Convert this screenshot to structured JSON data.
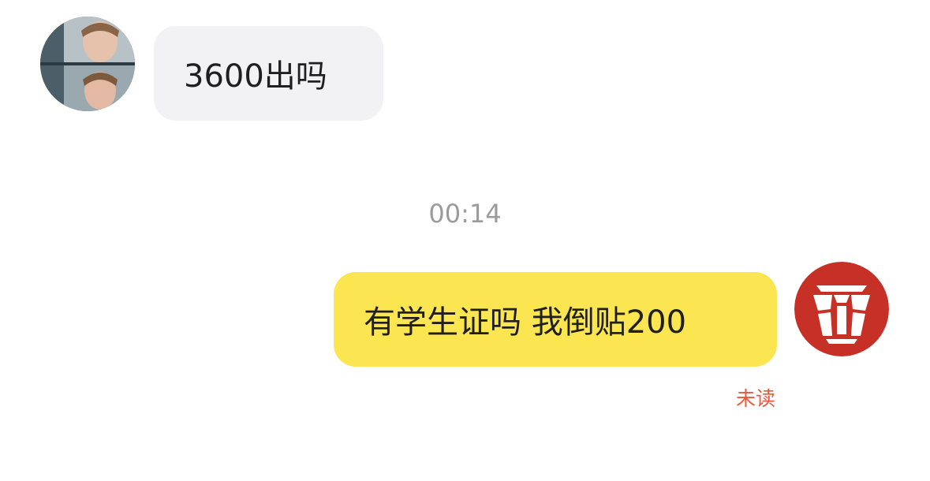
{
  "messages": [
    {
      "side": "left",
      "text": "3600出吗",
      "avatar": "user-photo-avatar"
    },
    {
      "side": "right",
      "text": "有学生证吗 我倒贴200",
      "avatar": "autobot-logo-avatar",
      "status": "未读"
    }
  ],
  "timestamp": "00:14",
  "colors": {
    "incoming_bubble": "#f2f2f4",
    "outgoing_bubble": "#fbe551",
    "unread_status": "#e55a3b",
    "timestamp": "#9b9b9b",
    "logo_red": "#c63027"
  }
}
